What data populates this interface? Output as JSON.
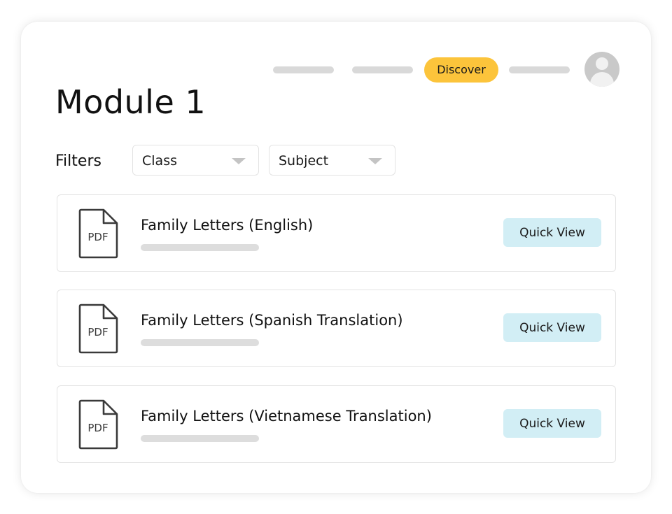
{
  "nav": {
    "active_item": "Discover",
    "accent_color": "#fcc43b",
    "avatar_icon": "user-avatar-icon"
  },
  "page": {
    "title": "Module 1"
  },
  "filters": {
    "label": "Filters",
    "class_dropdown": "Class",
    "subject_dropdown": "Subject"
  },
  "documents": [
    {
      "icon": "pdf-file-icon",
      "icon_text": "PDF",
      "title": "Family Letters (English)",
      "action": "Quick View"
    },
    {
      "icon": "pdf-file-icon",
      "icon_text": "PDF",
      "title": "Family Letters (Spanish Translation)",
      "action": "Quick View"
    },
    {
      "icon": "pdf-file-icon",
      "icon_text": "PDF",
      "title": "Family Letters (Vietnamese Translation)",
      "action": "Quick View"
    }
  ],
  "colors": {
    "quick_view_bg": "#d2eef5",
    "placeholder_gray": "#d9d9d9"
  }
}
